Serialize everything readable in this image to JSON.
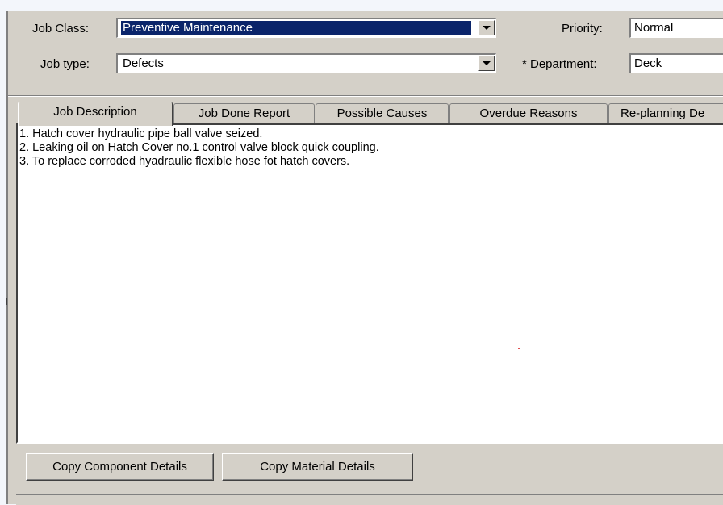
{
  "form": {
    "job_class_label": "Job Class:",
    "job_class_value": "Preventive Maintenance",
    "job_type_label": "Job type:",
    "job_type_value": "Defects",
    "priority_label": "Priority:",
    "priority_value": "Normal",
    "department_label": "* Department:",
    "department_value": "Deck"
  },
  "tabs": [
    {
      "label": "Job Description"
    },
    {
      "label": "Job Done Report"
    },
    {
      "label": "Possible Causes"
    },
    {
      "label": "Overdue Reasons"
    },
    {
      "label": "Re-planning De"
    }
  ],
  "description": {
    "lines": [
      "1. Hatch cover hydraulic pipe ball valve seized.",
      "2. Leaking oil on Hatch Cover no.1 control valve block quick coupling.",
      "3. To replace corroded hyadraulic flexible hose fot hatch covers."
    ]
  },
  "buttons": {
    "copy_component": "Copy Component Details",
    "copy_material": "Copy Material Details"
  },
  "colors": {
    "selection": "#0a246a",
    "face": "#d4d0c8"
  }
}
